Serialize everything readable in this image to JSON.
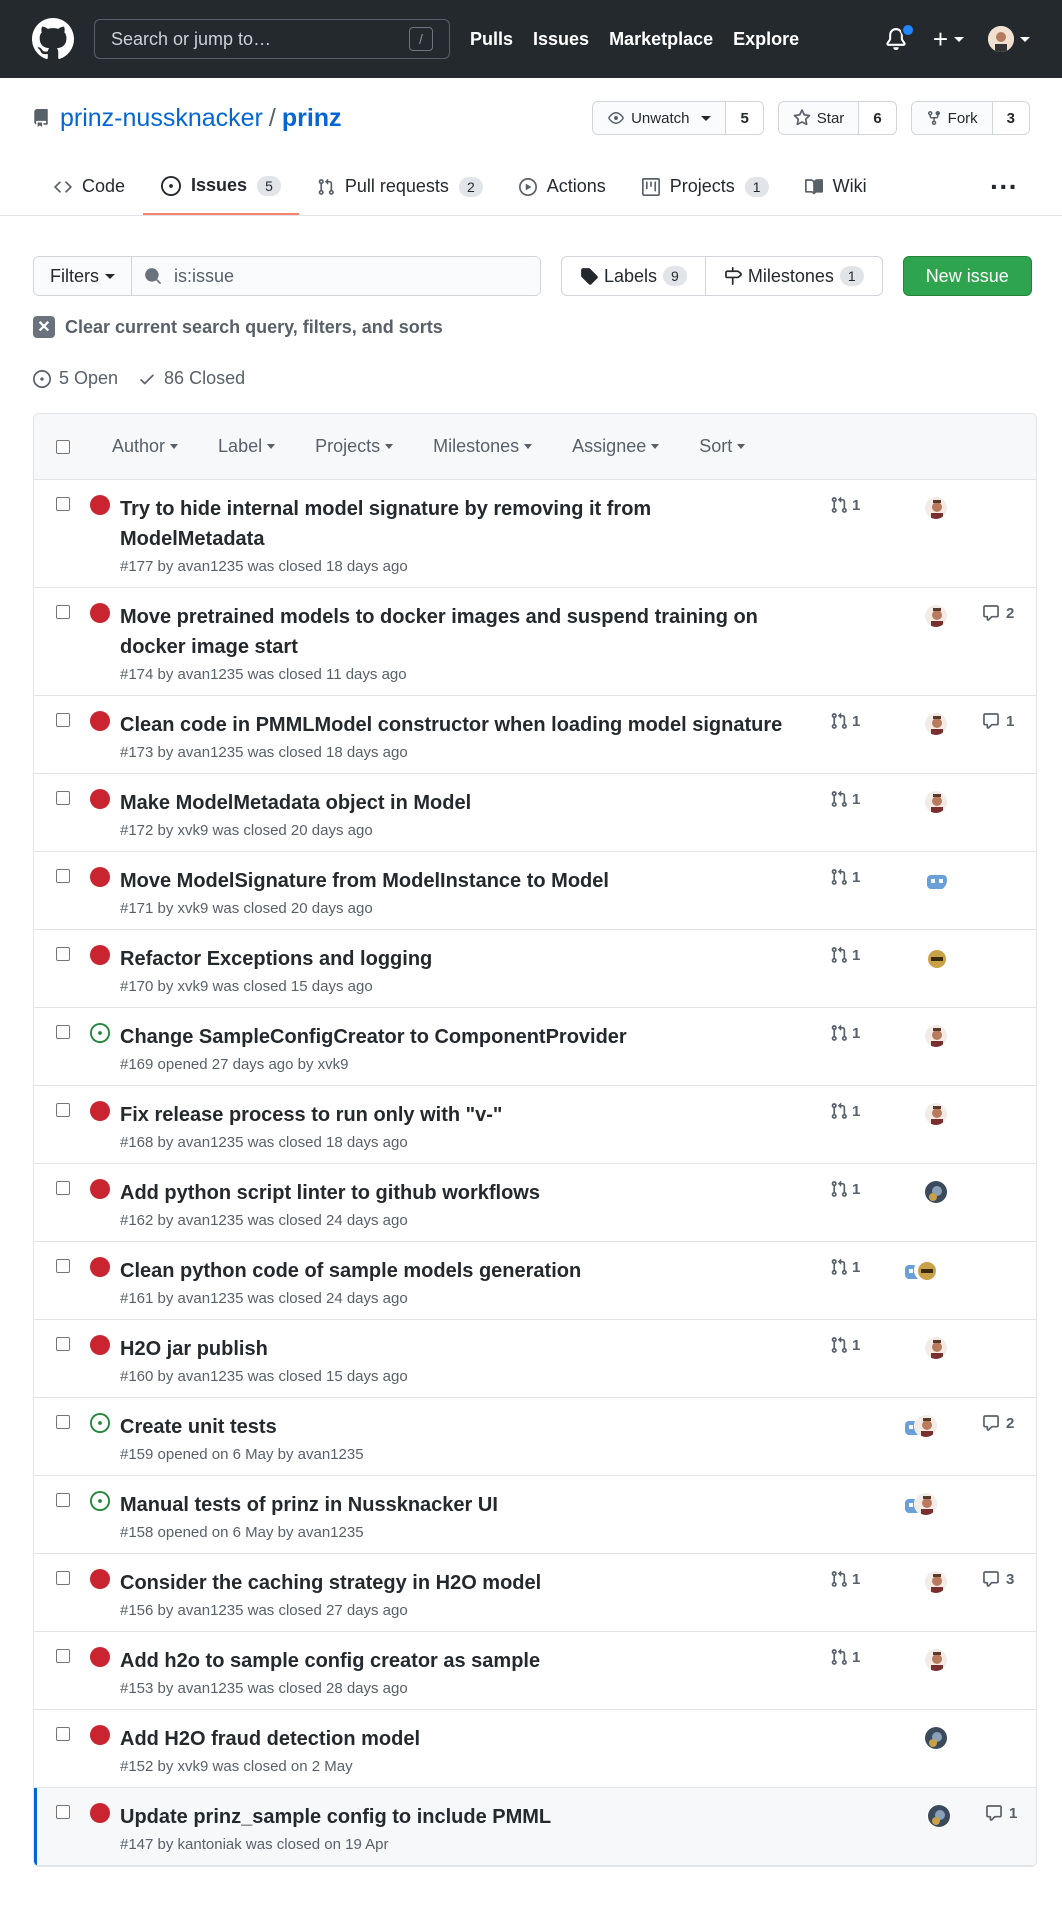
{
  "header": {
    "search_placeholder": "Search or jump to…",
    "search_key": "/",
    "nav": [
      "Pulls",
      "Issues",
      "Marketplace",
      "Explore"
    ],
    "plus": "+"
  },
  "repo": {
    "owner": "prinz-nussknacker",
    "sep": "/",
    "name": "prinz",
    "watch_label": "Unwatch",
    "watch_count": "5",
    "star_label": "Star",
    "star_count": "6",
    "fork_label": "Fork",
    "fork_count": "3"
  },
  "tabs": [
    {
      "label": "Code",
      "icon": "code-icon"
    },
    {
      "label": "Issues",
      "count": "5",
      "icon": "issue-icon"
    },
    {
      "label": "Pull requests",
      "count": "2",
      "icon": "pr-icon"
    },
    {
      "label": "Actions",
      "icon": "play-icon"
    },
    {
      "label": "Projects",
      "count": "1",
      "icon": "project-icon"
    },
    {
      "label": "Wiki",
      "icon": "book-icon"
    }
  ],
  "subnav": {
    "filters": "Filters",
    "query": "is:issue",
    "labels": "Labels",
    "labels_count": "9",
    "milestones": "Milestones",
    "milestones_count": "1",
    "new_issue": "New issue"
  },
  "clear_text": "Clear current search query, filters, and sorts",
  "states": {
    "open": "5 Open",
    "closed": "86 Closed"
  },
  "box_filters": [
    "Author",
    "Label",
    "Projects",
    "Milestones",
    "Assignee",
    "Sort"
  ],
  "issues": [
    {
      "title": "Try to hide internal model signature by removing it from ModelMetadata",
      "meta": "#177 by avan1235 was closed 18 days ago",
      "state": "closed",
      "pr": "1",
      "avatars": [
        "a"
      ],
      "comments": ""
    },
    {
      "title": "Move pretrained models to docker images and suspend training on docker image start",
      "meta": "#174 by avan1235 was closed 11 days ago",
      "state": "closed",
      "pr": "",
      "avatars": [
        "a"
      ],
      "comments": "2"
    },
    {
      "title": "Clean code in PMMLModel constructor when loading model signature",
      "meta": "#173 by avan1235 was closed 18 days ago",
      "state": "closed",
      "pr": "1",
      "avatars": [
        "a"
      ],
      "comments": "1"
    },
    {
      "title": "Make ModelMetadata object in Model",
      "meta": "#172 by xvk9 was closed 20 days ago",
      "state": "closed",
      "pr": "1",
      "avatars": [
        "a"
      ],
      "comments": ""
    },
    {
      "title": "Move ModelSignature from ModelInstance to Model",
      "meta": "#171 by xvk9 was closed 20 days ago",
      "state": "closed",
      "pr": "1",
      "avatars": [
        "b"
      ],
      "comments": ""
    },
    {
      "title": "Refactor Exceptions and logging",
      "meta": "#170 by xvk9 was closed 15 days ago",
      "state": "closed",
      "pr": "1",
      "avatars": [
        "c"
      ],
      "comments": ""
    },
    {
      "title": "Change SampleConfigCreator to ComponentProvider",
      "meta": "#169 opened 27 days ago by xvk9",
      "state": "open",
      "pr": "1",
      "avatars": [
        "a"
      ],
      "comments": ""
    },
    {
      "title": "Fix release process to run only with \"v-\"",
      "meta": "#168 by avan1235 was closed 18 days ago",
      "state": "closed",
      "pr": "1",
      "avatars": [
        "a"
      ],
      "comments": ""
    },
    {
      "title": "Add python script linter to github workflows",
      "meta": "#162 by avan1235 was closed 24 days ago",
      "state": "closed",
      "pr": "1",
      "avatars": [
        "d"
      ],
      "comments": ""
    },
    {
      "title": "Clean python code of sample models generation",
      "meta": "#161 by avan1235 was closed 24 days ago",
      "state": "closed",
      "pr": "1",
      "avatars": [
        "b",
        "c"
      ],
      "comments": ""
    },
    {
      "title": "H2O jar publish",
      "meta": "#160 by avan1235 was closed 15 days ago",
      "state": "closed",
      "pr": "1",
      "avatars": [
        "a"
      ],
      "comments": ""
    },
    {
      "title": "Create unit tests",
      "meta": "#159 opened on 6 May by avan1235",
      "state": "open",
      "pr": "",
      "avatars": [
        "b",
        "a"
      ],
      "comments": "2"
    },
    {
      "title": "Manual tests of prinz in Nussknacker UI",
      "meta": "#158 opened on 6 May by avan1235",
      "state": "open",
      "pr": "",
      "avatars": [
        "b",
        "a"
      ],
      "comments": ""
    },
    {
      "title": "Consider the caching strategy in H2O model",
      "meta": "#156 by avan1235 was closed 27 days ago",
      "state": "closed",
      "pr": "1",
      "avatars": [
        "a"
      ],
      "comments": "3"
    },
    {
      "title": "Add h2o to sample config creator as sample",
      "meta": "#153 by avan1235 was closed 28 days ago",
      "state": "closed",
      "pr": "1",
      "avatars": [
        "a"
      ],
      "comments": ""
    },
    {
      "title": "Add H2O fraud detection model",
      "meta": "#152 by xvk9 was closed on 2 May",
      "state": "closed",
      "pr": "",
      "avatars": [
        "d"
      ],
      "comments": ""
    },
    {
      "title": "Update prinz_sample config to include PMML",
      "meta": "#147 by kantoniak was closed on 19 Apr",
      "state": "closed",
      "pr": "",
      "avatars": [
        "d"
      ],
      "comments": "1",
      "highlight": true
    }
  ],
  "colors": {
    "closed": "#cb2431",
    "open": "#22863a",
    "green_button": "#2ea44f",
    "link": "#0366d6",
    "header": "#24292e"
  }
}
